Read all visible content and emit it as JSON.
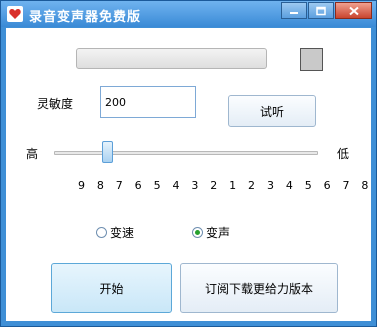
{
  "window": {
    "title": "录音变声器免费版",
    "icon": "heart-icon",
    "controls": [
      "minimize-icon",
      "maximize-icon",
      "close-icon"
    ]
  },
  "colors": {
    "titlebar": "#3f8fd6",
    "accent": "#5ca8d8",
    "swatch": "#c9c9c9",
    "radio_selected": "#26a02d"
  },
  "progress": {
    "value": 0
  },
  "sensitivity": {
    "label": "灵敏度",
    "value": "200",
    "listen_button": "试听"
  },
  "pitch": {
    "high_label": "高",
    "low_label": "低",
    "scale": "9 8 7 6 5 4 3 2 1 2 3 4 5 6 7 8 9",
    "position": 6
  },
  "mode": {
    "options": [
      {
        "label": "变速",
        "checked": false
      },
      {
        "label": "变声",
        "checked": true
      }
    ]
  },
  "actions": {
    "start": "开始",
    "upgrade": "订阅下载更给力版本"
  }
}
